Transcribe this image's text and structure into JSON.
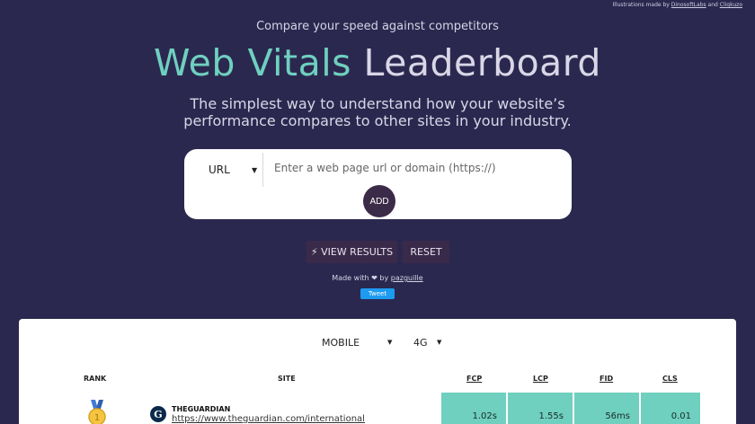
{
  "credits": {
    "prefix": "Illustrations made by ",
    "link1": "DinosoftLabs",
    "middle": " and ",
    "link2": "Cliqkuzo"
  },
  "hero": {
    "kicker": "Compare your speed against competitors",
    "title_accent": "Web Vitals",
    "title_rest": " Leaderboard",
    "tagline_line1": "The simplest way to understand how your website’s",
    "tagline_line2": "performance compares to other sites in your industry."
  },
  "form": {
    "type_selected": "URL",
    "url_placeholder": "Enter a web page url or domain (https://)",
    "url_value": "",
    "add_label": "ADD"
  },
  "actions": {
    "view_results": "⚡ VIEW RESULTS",
    "reset": "RESET"
  },
  "footer": {
    "made_with_prefix": "Made with ❤ by ",
    "author": "pazguille",
    "tweet": "Tweet"
  },
  "filters": {
    "device_selected": "MOBILE",
    "connection_selected": "4G"
  },
  "table": {
    "headers": {
      "rank": "RANK",
      "site": "SITE",
      "fcp": "FCP",
      "lcp": "LCP",
      "fid": "FID",
      "cls": "CLS"
    },
    "rows": [
      {
        "rank_icon": "gold-medal-icon",
        "rank": "1",
        "site_name": "THEGUARDIAN",
        "site_url": "https://www.theguardian.com/international",
        "logo_letter": "G",
        "fcp": "1.02s",
        "lcp": "1.55s",
        "fid": "56ms",
        "cls": "0.01"
      }
    ]
  },
  "colors": {
    "background": "#2b2850",
    "accent": "#6fd0bf",
    "button": "#3a2a49",
    "good_metric": "#6fd0bf"
  }
}
